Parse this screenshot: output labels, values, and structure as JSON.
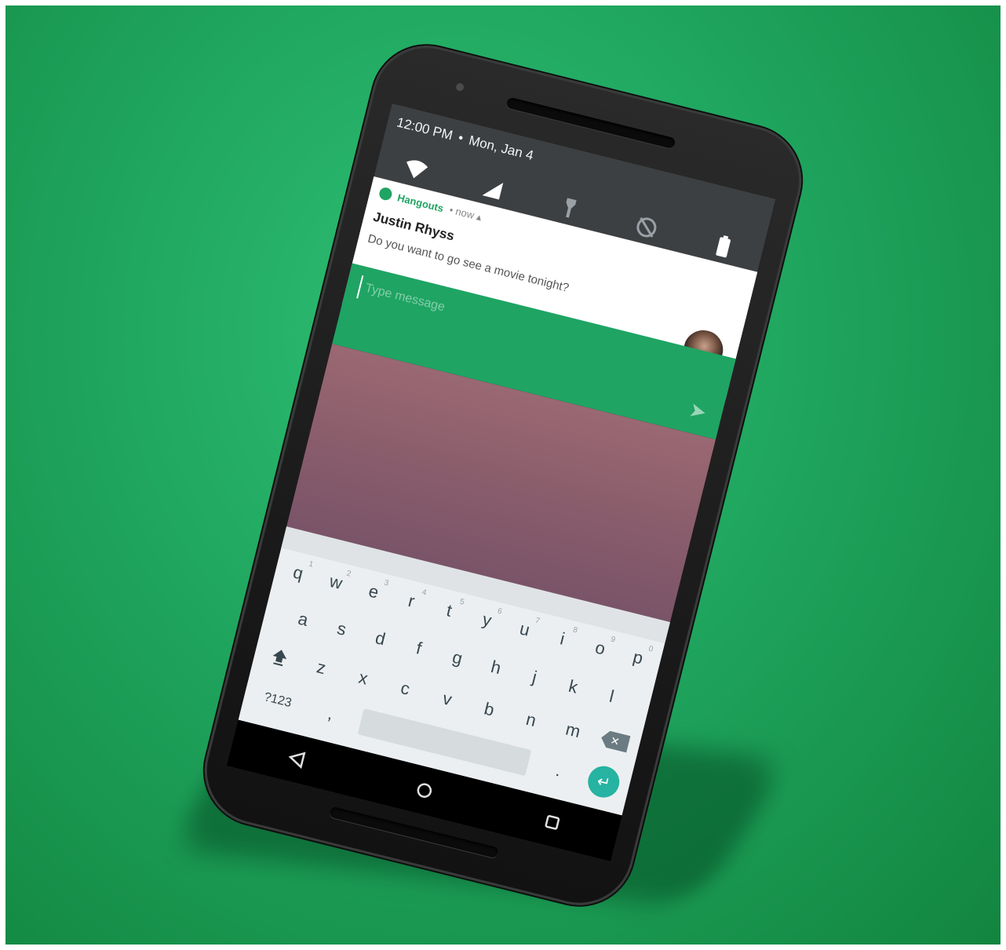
{
  "status_bar": {
    "time": "12:00 PM",
    "separator": "•",
    "date": "Mon, Jan 4",
    "quick_settings_icons": [
      "wifi-icon",
      "cell-signal-icon",
      "flashlight-icon",
      "do-not-disturb-off-icon",
      "battery-icon"
    ]
  },
  "notification": {
    "app_name": "Hangouts",
    "meta": "• now ▴",
    "sender": "Justin Rhyss",
    "message": "Do you want to go see a movie tonight?"
  },
  "reply": {
    "placeholder": "Type message"
  },
  "keyboard": {
    "row1": [
      {
        "key": "q",
        "hint": "1"
      },
      {
        "key": "w",
        "hint": "2"
      },
      {
        "key": "e",
        "hint": "3"
      },
      {
        "key": "r",
        "hint": "4"
      },
      {
        "key": "t",
        "hint": "5"
      },
      {
        "key": "y",
        "hint": "6"
      },
      {
        "key": "u",
        "hint": "7"
      },
      {
        "key": "i",
        "hint": "8"
      },
      {
        "key": "o",
        "hint": "9"
      },
      {
        "key": "p",
        "hint": "0"
      }
    ],
    "row2": [
      "a",
      "s",
      "d",
      "f",
      "g",
      "h",
      "j",
      "k",
      "l"
    ],
    "row3": [
      "z",
      "x",
      "c",
      "v",
      "b",
      "n",
      "m"
    ],
    "symbols_label": "?123",
    "comma": ",",
    "period": "."
  },
  "colors": {
    "background": "#1fa55e",
    "hangouts_green": "#1fa463",
    "enter_key": "#26b3a1",
    "wallpaper": "#8a5d6c"
  }
}
